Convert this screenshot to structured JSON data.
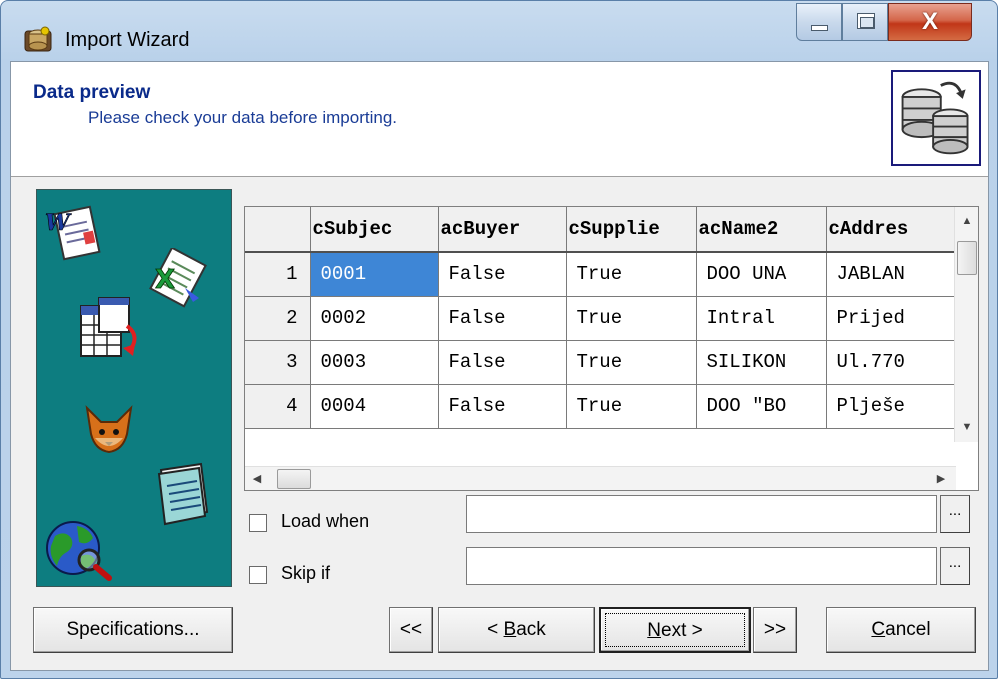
{
  "window": {
    "title": "Import Wizard",
    "controls": {
      "minimize": "minimize",
      "maximize": "maximize",
      "close": "X"
    }
  },
  "header": {
    "title": "Data preview",
    "subtitle": "Please check your data before importing."
  },
  "grid": {
    "columns": [
      "cSubjec",
      "acBuyer",
      "cSupplie",
      "acName2",
      "cAddres"
    ],
    "rows": [
      {
        "num": "1",
        "cells": [
          "0001",
          "False",
          "True",
          "DOO UNA",
          "JABLAN"
        ]
      },
      {
        "num": "2",
        "cells": [
          "0002",
          "False",
          "True",
          "Intral",
          "Prijed"
        ]
      },
      {
        "num": "3",
        "cells": [
          "0003",
          "False",
          "True",
          "SILIKON",
          "Ul.770"
        ]
      },
      {
        "num": "4",
        "cells": [
          "0004",
          "False",
          "True",
          "DOO \"BO",
          "Plješe"
        ]
      }
    ],
    "selected_cell": {
      "row": 1,
      "column": "cSubjec"
    }
  },
  "conditions": {
    "load_when": {
      "label": "Load when",
      "checked": false,
      "value": "",
      "browse": "..."
    },
    "skip_if": {
      "label": "Skip if",
      "checked": false,
      "value": "",
      "browse": "..."
    }
  },
  "buttons": {
    "specifications": "Specifications...",
    "first": "<<",
    "back_pre": "< ",
    "back_u": "B",
    "back_post": "ack",
    "next_u": "N",
    "next_post": "ext >",
    "last": ">>",
    "cancel_u": "C",
    "cancel_post": "ancel"
  },
  "colors": {
    "side_panel": "#0d7d80",
    "header_title": "#0a2a8a",
    "selection": "#3e86d6",
    "close_button": "#c13618"
  },
  "icons": {
    "app": "database-wizard-icon",
    "header": "database-transfer-icon",
    "side": [
      "word-document-icon",
      "excel-document-icon",
      "table-link-icon",
      "foxpro-icon",
      "notepad-icon",
      "globe-search-icon"
    ]
  }
}
